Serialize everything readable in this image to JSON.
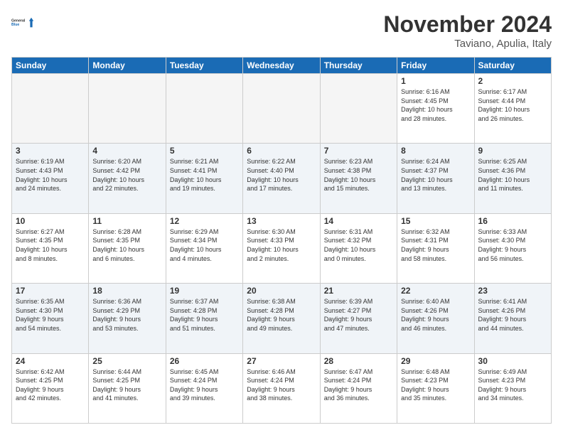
{
  "header": {
    "logo_text_general": "General",
    "logo_text_blue": "Blue",
    "month": "November 2024",
    "location": "Taviano, Apulia, Italy"
  },
  "weekdays": [
    "Sunday",
    "Monday",
    "Tuesday",
    "Wednesday",
    "Thursday",
    "Friday",
    "Saturday"
  ],
  "weeks": [
    [
      {
        "day": "",
        "info": ""
      },
      {
        "day": "",
        "info": ""
      },
      {
        "day": "",
        "info": ""
      },
      {
        "day": "",
        "info": ""
      },
      {
        "day": "",
        "info": ""
      },
      {
        "day": "1",
        "info": "Sunrise: 6:16 AM\nSunset: 4:45 PM\nDaylight: 10 hours\nand 28 minutes."
      },
      {
        "day": "2",
        "info": "Sunrise: 6:17 AM\nSunset: 4:44 PM\nDaylight: 10 hours\nand 26 minutes."
      }
    ],
    [
      {
        "day": "3",
        "info": "Sunrise: 6:19 AM\nSunset: 4:43 PM\nDaylight: 10 hours\nand 24 minutes."
      },
      {
        "day": "4",
        "info": "Sunrise: 6:20 AM\nSunset: 4:42 PM\nDaylight: 10 hours\nand 22 minutes."
      },
      {
        "day": "5",
        "info": "Sunrise: 6:21 AM\nSunset: 4:41 PM\nDaylight: 10 hours\nand 19 minutes."
      },
      {
        "day": "6",
        "info": "Sunrise: 6:22 AM\nSunset: 4:40 PM\nDaylight: 10 hours\nand 17 minutes."
      },
      {
        "day": "7",
        "info": "Sunrise: 6:23 AM\nSunset: 4:38 PM\nDaylight: 10 hours\nand 15 minutes."
      },
      {
        "day": "8",
        "info": "Sunrise: 6:24 AM\nSunset: 4:37 PM\nDaylight: 10 hours\nand 13 minutes."
      },
      {
        "day": "9",
        "info": "Sunrise: 6:25 AM\nSunset: 4:36 PM\nDaylight: 10 hours\nand 11 minutes."
      }
    ],
    [
      {
        "day": "10",
        "info": "Sunrise: 6:27 AM\nSunset: 4:35 PM\nDaylight: 10 hours\nand 8 minutes."
      },
      {
        "day": "11",
        "info": "Sunrise: 6:28 AM\nSunset: 4:35 PM\nDaylight: 10 hours\nand 6 minutes."
      },
      {
        "day": "12",
        "info": "Sunrise: 6:29 AM\nSunset: 4:34 PM\nDaylight: 10 hours\nand 4 minutes."
      },
      {
        "day": "13",
        "info": "Sunrise: 6:30 AM\nSunset: 4:33 PM\nDaylight: 10 hours\nand 2 minutes."
      },
      {
        "day": "14",
        "info": "Sunrise: 6:31 AM\nSunset: 4:32 PM\nDaylight: 10 hours\nand 0 minutes."
      },
      {
        "day": "15",
        "info": "Sunrise: 6:32 AM\nSunset: 4:31 PM\nDaylight: 9 hours\nand 58 minutes."
      },
      {
        "day": "16",
        "info": "Sunrise: 6:33 AM\nSunset: 4:30 PM\nDaylight: 9 hours\nand 56 minutes."
      }
    ],
    [
      {
        "day": "17",
        "info": "Sunrise: 6:35 AM\nSunset: 4:30 PM\nDaylight: 9 hours\nand 54 minutes."
      },
      {
        "day": "18",
        "info": "Sunrise: 6:36 AM\nSunset: 4:29 PM\nDaylight: 9 hours\nand 53 minutes."
      },
      {
        "day": "19",
        "info": "Sunrise: 6:37 AM\nSunset: 4:28 PM\nDaylight: 9 hours\nand 51 minutes."
      },
      {
        "day": "20",
        "info": "Sunrise: 6:38 AM\nSunset: 4:28 PM\nDaylight: 9 hours\nand 49 minutes."
      },
      {
        "day": "21",
        "info": "Sunrise: 6:39 AM\nSunset: 4:27 PM\nDaylight: 9 hours\nand 47 minutes."
      },
      {
        "day": "22",
        "info": "Sunrise: 6:40 AM\nSunset: 4:26 PM\nDaylight: 9 hours\nand 46 minutes."
      },
      {
        "day": "23",
        "info": "Sunrise: 6:41 AM\nSunset: 4:26 PM\nDaylight: 9 hours\nand 44 minutes."
      }
    ],
    [
      {
        "day": "24",
        "info": "Sunrise: 6:42 AM\nSunset: 4:25 PM\nDaylight: 9 hours\nand 42 minutes."
      },
      {
        "day": "25",
        "info": "Sunrise: 6:44 AM\nSunset: 4:25 PM\nDaylight: 9 hours\nand 41 minutes."
      },
      {
        "day": "26",
        "info": "Sunrise: 6:45 AM\nSunset: 4:24 PM\nDaylight: 9 hours\nand 39 minutes."
      },
      {
        "day": "27",
        "info": "Sunrise: 6:46 AM\nSunset: 4:24 PM\nDaylight: 9 hours\nand 38 minutes."
      },
      {
        "day": "28",
        "info": "Sunrise: 6:47 AM\nSunset: 4:24 PM\nDaylight: 9 hours\nand 36 minutes."
      },
      {
        "day": "29",
        "info": "Sunrise: 6:48 AM\nSunset: 4:23 PM\nDaylight: 9 hours\nand 35 minutes."
      },
      {
        "day": "30",
        "info": "Sunrise: 6:49 AM\nSunset: 4:23 PM\nDaylight: 9 hours\nand 34 minutes."
      }
    ]
  ]
}
